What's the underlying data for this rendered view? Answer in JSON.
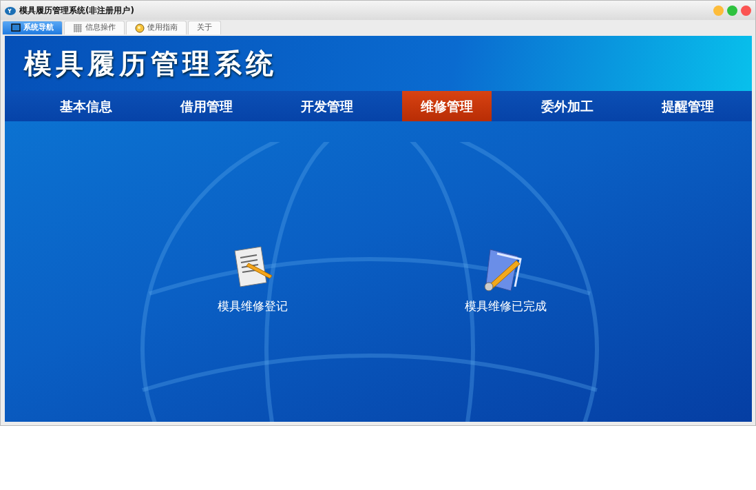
{
  "window": {
    "title": "模具履历管理系统(非注册用户)"
  },
  "tabs": [
    {
      "label": "系统导航",
      "selected": true,
      "kind": "monitor"
    },
    {
      "label": "信息操作",
      "selected": false,
      "kind": "grid"
    },
    {
      "label": "使用指南",
      "selected": false,
      "kind": "bulb"
    },
    {
      "label": "关于",
      "selected": false,
      "kind": "none"
    }
  ],
  "banner": {
    "title": "模具履历管理系统"
  },
  "menu": [
    {
      "label": "基本信息",
      "selected": false
    },
    {
      "label": "借用管理",
      "selected": false
    },
    {
      "label": "开发管理",
      "selected": false
    },
    {
      "label": "维修管理",
      "selected": true
    },
    {
      "label": "委外加工",
      "selected": false
    },
    {
      "label": "提醒管理",
      "selected": false
    }
  ],
  "actions": [
    {
      "label": "模具维修登记",
      "kind": "document"
    },
    {
      "label": "模具维修已完成",
      "kind": "folder"
    }
  ]
}
